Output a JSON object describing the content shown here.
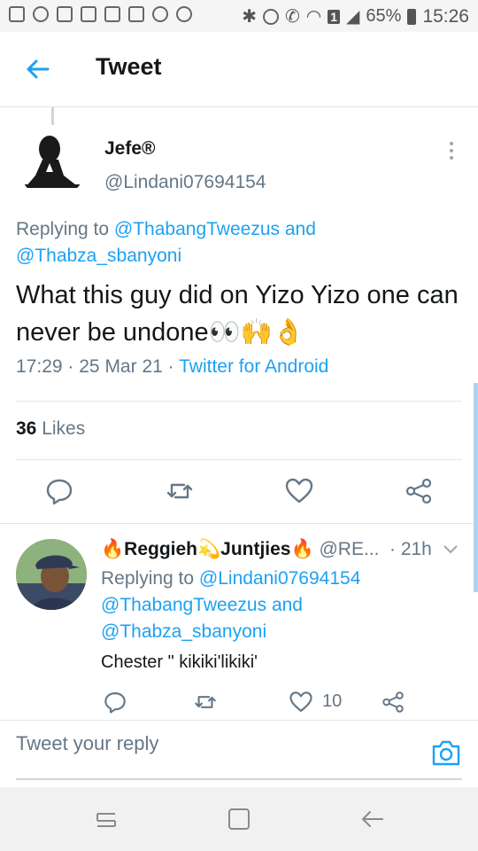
{
  "status_bar": {
    "battery": "65%",
    "time": "15:26",
    "sim_badge": "1"
  },
  "header": {
    "title": "Tweet"
  },
  "tweet": {
    "author_name": "Jefe®",
    "author_handle": "@Lindani07694154",
    "replying_prefix": "Replying to",
    "replying_to_1": "@ThabangTweezus",
    "replying_and": "and",
    "replying_to_2": "@Thabza_sbanyoni",
    "text": "What this guy did on Yizo Yizo one can never be undone👀🙌👌",
    "time": "17:29",
    "date": "25 Mar 21",
    "source": "Twitter for Android",
    "likes_count": "36",
    "likes_label": "Likes"
  },
  "reply": {
    "author_name": "🔥Reggieh💫Juntjies🔥",
    "author_handle": "@RE...",
    "time": "· 21h",
    "replying_prefix": "Replying to",
    "replying_to_1": "@Lindani07694154",
    "replying_to_2": "@ThabangTweezus",
    "replying_and": "and",
    "replying_to_3": "@Thabza_sbanyoni",
    "text": "Chester \" kikiki'likiki'",
    "like_count": "10"
  },
  "compose": {
    "placeholder": "Tweet your reply"
  },
  "colors": {
    "accent": "#1da1f2",
    "secondary_text": "#657786",
    "primary_text": "#14171a"
  }
}
